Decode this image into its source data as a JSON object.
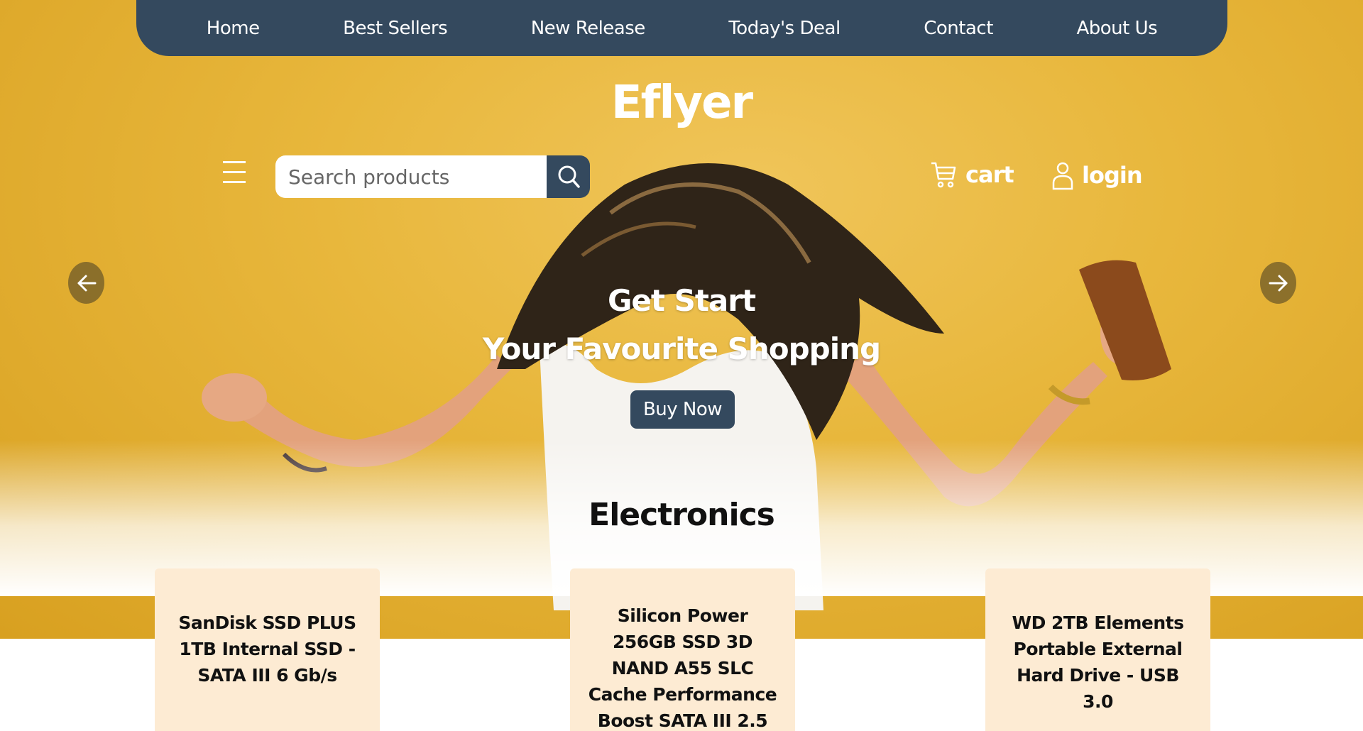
{
  "nav": {
    "items": [
      {
        "label": "Home"
      },
      {
        "label": "Best Sellers"
      },
      {
        "label": "New Release"
      },
      {
        "label": "Today's Deal"
      },
      {
        "label": "Contact"
      },
      {
        "label": "About Us"
      }
    ]
  },
  "brand": {
    "logo": "Eflyer"
  },
  "search": {
    "placeholder": "Search products",
    "value": ""
  },
  "header_actions": {
    "cart_label": "cart",
    "login_label": "login"
  },
  "hero": {
    "title_line1": "Get Start",
    "title_line2": "Your Favourite Shopping",
    "cta_label": "Buy Now"
  },
  "section": {
    "title": "Electronics"
  },
  "products": [
    {
      "title": "SanDisk SSD PLUS 1TB Internal SSD - SATA III 6 Gb/s"
    },
    {
      "title": "Silicon Power 256GB SSD 3D NAND A55 SLC Cache Performance Boost SATA III 2.5"
    },
    {
      "title": "WD 2TB Elements Portable External Hard Drive - USB 3.0"
    }
  ],
  "colors": {
    "navbar": "#34495e",
    "hero_background": "#e8b73c",
    "card_background": "#fdebd3",
    "button": "#34495e"
  },
  "icons": {
    "menu": "hamburger-icon",
    "search": "search-icon",
    "cart": "cart-icon",
    "login": "user-icon",
    "prev": "arrow-left-icon",
    "next": "arrow-right-icon"
  }
}
